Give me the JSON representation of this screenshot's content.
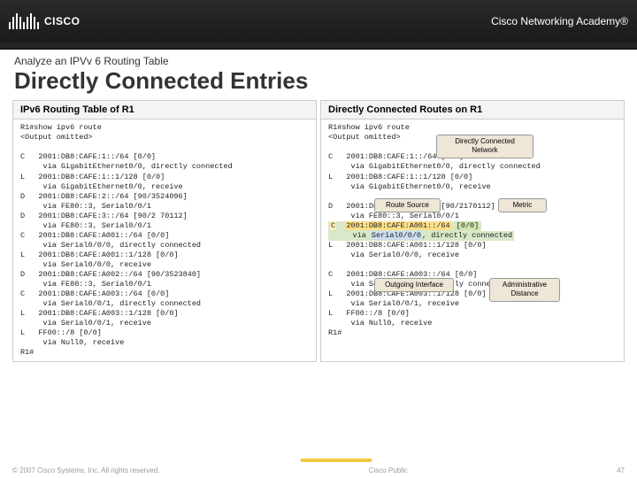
{
  "header": {
    "brand": "CISCO",
    "academy": "Cisco Networking Academy®"
  },
  "titles": {
    "section": "Analyze an IPVv 6 Routing Table",
    "page": "Directly Connected Entries"
  },
  "left_panel": {
    "title": "IPv6 Routing Table of R1",
    "cmd": "R1#show ipv6 route",
    "omit": "<Output omitted>",
    "lines": [
      "C   2001:DB8:CAFE:1::/64 [0/0]",
      "     via GigabitEthernet0/0, directly connected",
      "L   2001:DB8:CAFE:1::1/128 [0/0]",
      "     via GigabitEthernet0/0, receive",
      "D   2001:DB8:CAFE:2::/64 [90/3524096]",
      "     via FE80::3, Serial0/0/1",
      "D   2001:DB8:CAFE:3::/64 [90/2 70112]",
      "     via FE80::3, Serial0/0/1",
      "C   2001:DB8:CAFE:A001::/64 [0/0]",
      "     via Serial0/0/0, directly connected",
      "L   2001:DB8:CAFE:A001::1/128 [0/0]",
      "     via Serial0/0/0, receive",
      "D   2001:DB8:CAFE:A002::/64 [90/3523840]",
      "     via FE80::3, Serial0/0/1",
      "C   2001:DB8:CAFE:A003::/64 [0/0]",
      "     via Serial0/0/1, directly connected",
      "L   2001:DB8:CAFE:A003::1/128 [0/0]",
      "     via Serial0/0/1, receive",
      "L   FF00::/8 [0/0]",
      "     via Null0, receive",
      "R1#"
    ]
  },
  "right_panel": {
    "title": "Directly Connected Routes on R1",
    "cmd": "R1#show ipv6 route",
    "omit": "<Output omitted>",
    "callouts": {
      "top": "Directly Connected Network",
      "route_source": "Route Source",
      "metric": "Metric",
      "out_if": "Outgoing Interface",
      "admin_dist": "Administrative Distance"
    },
    "lines_upper": [
      "C   2001:DB8:CAFE:1::/64 [0/0]",
      "     via GigabitEthernet0/0, directly connected",
      "L   2001:DB8:CAFE:1::1/128 [0/0]",
      "     via GigabitEthernet0/0, receive"
    ],
    "lines_mid_pre": [
      "D   2001:DB8:CAFE:3::/64 [90/2170112]",
      "     via FE80::3, Serial0/0/1"
    ],
    "hl_code": "C",
    "hl_route": "2001:DB8:CAFE:A001::/64",
    "hl_ad": "[0/0]",
    "hl_via": "     via ",
    "hl_if": "Serial0/0/0",
    "hl_tail": ", directly connected",
    "lines_after": [
      "L   2001:DB8:CAFE:A001::1/128 [0/0]",
      "     via Serial0/0/0, receive"
    ],
    "lines_lower": [
      "C   2001:DB8:CAFE:A003::/64 [0/0]",
      "     via Serial0/0/1, directly connected",
      "L   2001:DB8:CAFE:A003::1/128 [0/0]",
      "     via Serial0/0/1, receive",
      "L   FF00::/8 [0/0]",
      "     via Null0, receive",
      "R1#"
    ]
  },
  "footer": {
    "copyright": "© 2007 Cisco Systems, Inc. All rights reserved.",
    "class": "Cisco Public",
    "page": "47"
  }
}
